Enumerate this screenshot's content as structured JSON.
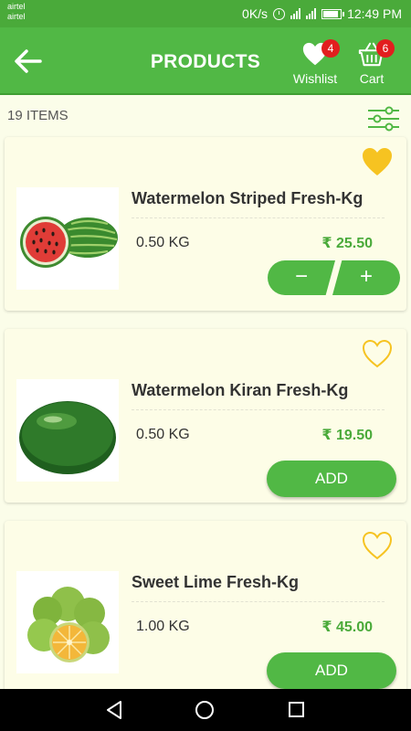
{
  "status": {
    "carrier_1": "airtel",
    "carrier_2": "airtel",
    "speed": "0K/s",
    "battery": "",
    "time": "12:49 PM"
  },
  "header": {
    "title": "PRODUCTS",
    "wishlist_label": "Wishlist",
    "wishlist_count": "4",
    "cart_label": "Cart",
    "cart_count": "6"
  },
  "toolbar": {
    "items_count": "19 ITEMS"
  },
  "products": [
    {
      "name": "Watermelon Striped Fresh-Kg",
      "weight": "0.50 KG",
      "price": "₹ 25.50",
      "favorited": true,
      "qty_minus": "−",
      "qty_plus": "+"
    },
    {
      "name": "Watermelon Kiran Fresh-Kg",
      "weight": "0.50 KG",
      "price": "₹ 19.50",
      "favorited": false,
      "add_label": "ADD"
    },
    {
      "name": "Sweet Lime Fresh-Kg",
      "weight": "1.00 KG",
      "price": "₹ 45.00",
      "favorited": false,
      "add_label": "ADD"
    }
  ],
  "colors": {
    "primary": "#51b845",
    "status_bar": "#4aaa3a",
    "price": "#4aaa3a",
    "favorite": "#f6c321",
    "badge": "#e21e1e",
    "background": "#fbfde9"
  },
  "icons": [
    "back-arrow-icon",
    "heart-icon",
    "basket-icon",
    "filter-sliders-icon",
    "clock-icon",
    "signal-icon",
    "battery-icon"
  ]
}
